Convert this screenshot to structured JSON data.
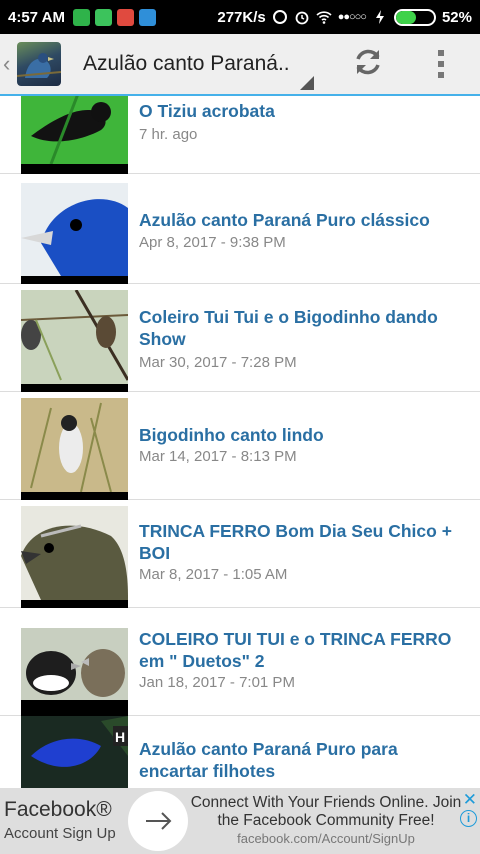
{
  "status_bar": {
    "time": "4:57 AM",
    "network_speed": "277K/s",
    "signal": "●●○○○",
    "battery_text": "52%",
    "battery_level": 0.52
  },
  "app_bar": {
    "title": "Azulão canto Paraná..",
    "refresh_icon": "refresh-icon",
    "overflow_icon": "more-vert-icon"
  },
  "videos": [
    {
      "title": "O Tiziu acrobata",
      "date": "7 hr. ago"
    },
    {
      "title": "Azulão canto Paraná Puro clássico",
      "date": "Apr 8, 2017 - 9:38 PM"
    },
    {
      "title": "Coleiro Tui Tui e o Bigodinho dando Show",
      "date": "Mar 30, 2017 - 7:28 PM"
    },
    {
      "title": "Bigodinho canto lindo",
      "date": "Mar 14, 2017 - 8:13 PM"
    },
    {
      "title": "TRINCA FERRO Bom Dia Seu Chico + BOI",
      "date": "Mar 8, 2017 - 1:05 AM"
    },
    {
      "title": "COLEIRO TUI TUI e o TRINCA FERRO em \" Duetos\" 2",
      "date": "Jan 18, 2017 - 7:01 PM"
    },
    {
      "title": "Azulão canto Paraná Puro para encartar filhotes",
      "date": ""
    }
  ],
  "ad": {
    "brand": "Facebook®",
    "sub": "Account Sign Up",
    "text": "Connect With Your Friends Online. Join the Facebook Community Free!",
    "url": "facebook.com/Account/SignUp",
    "close": "✕",
    "info": "i"
  }
}
